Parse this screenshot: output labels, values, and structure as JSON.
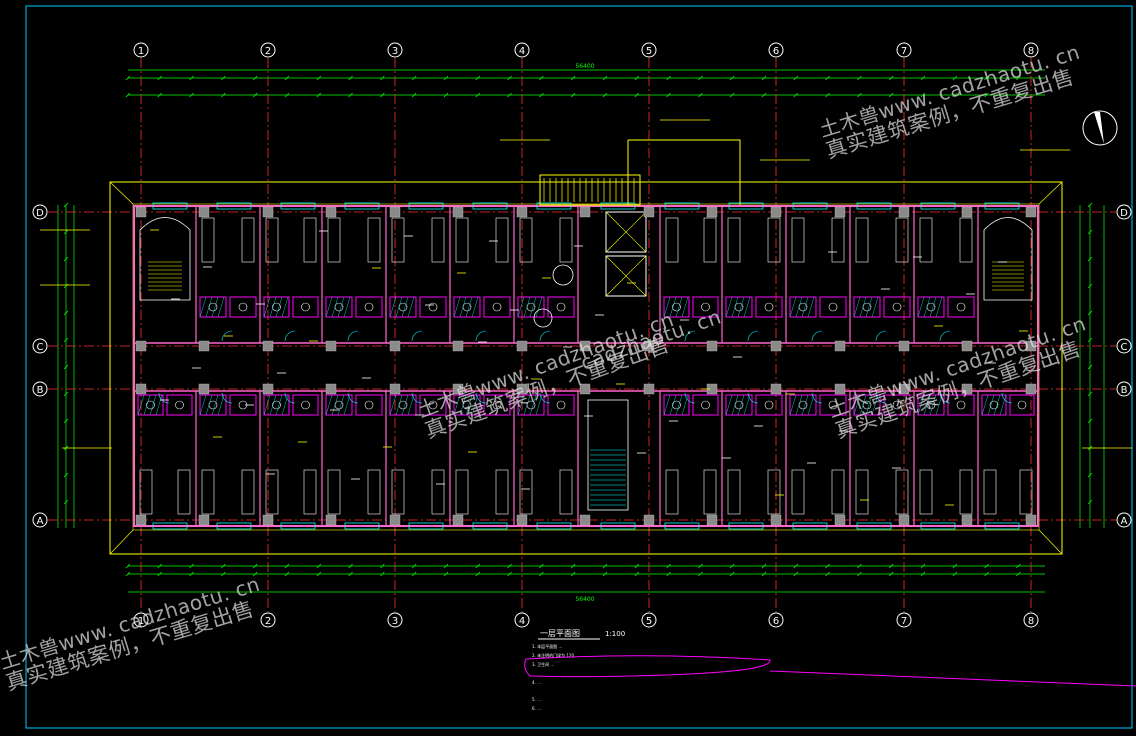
{
  "drawing": {
    "axis_labels_horizontal": [
      "1",
      "2",
      "3",
      "4",
      "5",
      "6",
      "7",
      "8"
    ],
    "axis_labels_vertical": [
      "D",
      "C",
      "B",
      "A"
    ],
    "title_block": {
      "title": "一层平面图",
      "scale": "1:100",
      "notes": [
        "1. 本层平面图 …",
        "2. 未注明的门垛为 120",
        "3. 卫生间 …",
        "4. …",
        "5. …",
        "6. …"
      ]
    },
    "total_dimension": "56400",
    "colors": {
      "background": "#000000",
      "axis_line": "#ff3030",
      "wall": "#ff66cc",
      "column": "#8a8a8a",
      "dimension": "#00ff00",
      "text_yellow": "#ffff00",
      "fixture_magenta": "#ff00ff",
      "cyan": "#00ffff",
      "frame": "#00ccff",
      "white": "#ffffff"
    }
  },
  "watermarks": [
    {
      "line1": "土木兽www. cadzhaotu. cn",
      "line2": "真实建筑案例，不重复出售"
    },
    {
      "line1": "土木兽www. cadzhaotu. cn",
      "line2": "真实建筑案例，不重复出售"
    },
    {
      "line1": "土木兽www. cadzhaotu. cn",
      "line2": "真实建筑案例，不重复出售"
    },
    {
      "line1": "土木兽www. cadzhaotu. cn",
      "line2": "真实建筑案例，不重复出售"
    },
    {
      "line1": "cadzhaotu. cn",
      "line2": ""
    }
  ]
}
